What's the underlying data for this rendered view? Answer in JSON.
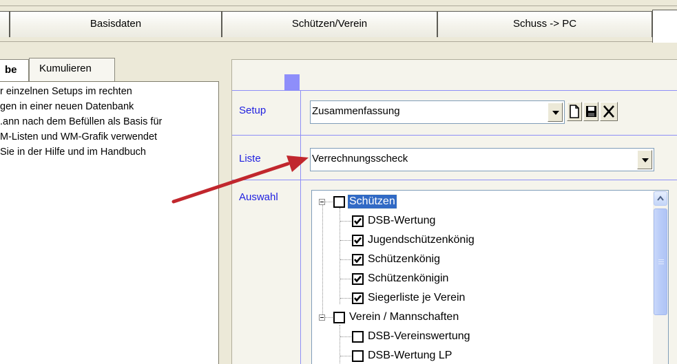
{
  "top_tabs": [
    {
      "label": ""
    },
    {
      "label": "Basisdaten"
    },
    {
      "label": "Schützen/Verein"
    },
    {
      "label": "Schuss -> PC"
    },
    {
      "label": ""
    }
  ],
  "left": {
    "subtabs": [
      {
        "label": "be"
      },
      {
        "label": "Kumulieren"
      }
    ],
    "text_lines": [
      "r einzelnen Setups im rechten",
      "gen in einer neuen Datenbank",
      ".ann nach dem Befüllen als Basis für",
      "M-Listen und WM-Grafik verwendet",
      " Sie in der Hilfe und im Handbuch"
    ]
  },
  "right": {
    "setup": {
      "label": "Setup",
      "value": "Zusammenfassung"
    },
    "liste": {
      "label": "Liste",
      "value": "Verrechnungsscheck"
    },
    "auswahl": {
      "label": "Auswahl"
    },
    "toolbar_icons": [
      "new-document-icon",
      "save-disk-icon",
      "delete-x-icon"
    ],
    "tree": [
      {
        "label": "Schützen",
        "level": 0,
        "checked": false,
        "selected": true
      },
      {
        "label": "DSB-Wertung",
        "level": 1,
        "checked": true
      },
      {
        "label": "Jugendschützenkönig",
        "level": 1,
        "checked": true
      },
      {
        "label": "Schützenkönig",
        "level": 1,
        "checked": true
      },
      {
        "label": "Schützenkönigin",
        "level": 1,
        "checked": true
      },
      {
        "label": "Siegerliste je Verein",
        "level": 1,
        "checked": true
      },
      {
        "label": "Verein / Mannschaften",
        "level": 0,
        "checked": false
      },
      {
        "label": "DSB-Vereinswertung",
        "level": 1,
        "checked": false
      },
      {
        "label": "DSB-Wertung LP",
        "level": 1,
        "checked": false
      }
    ]
  },
  "colors": {
    "window_bg": "#ece9d8",
    "field_label": "#1e1ee0",
    "selection": "#316ac5",
    "annotation_arrow": "#c1272d"
  }
}
